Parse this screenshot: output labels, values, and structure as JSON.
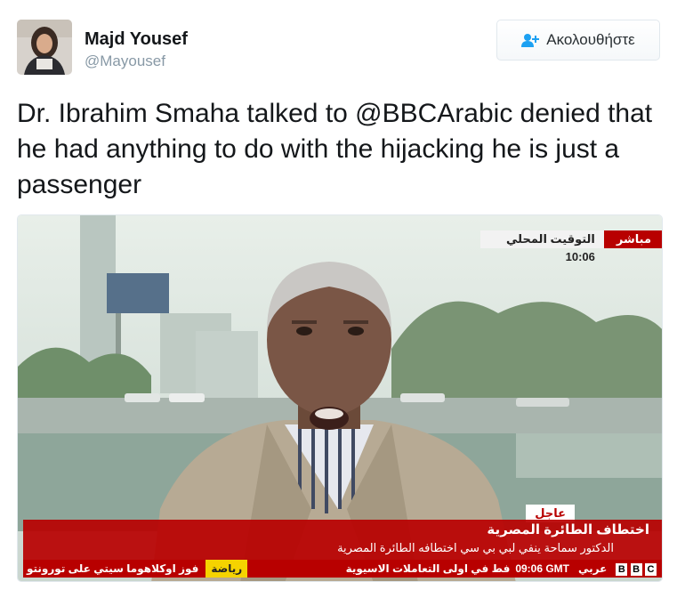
{
  "author": {
    "name": "Majd Yousef",
    "handle": "@Mayousef"
  },
  "follow_button": {
    "label": "Ακολουθήστε",
    "icon": "add-user-icon"
  },
  "tweet": {
    "text": "Dr. Ibrahim Smaha talked to @BBCArabic denied that he had anything to do with the hijacking he is just a passenger"
  },
  "broadcast": {
    "live_label": "مباشر",
    "local_time_label": "التوقيت المحلي 10:06",
    "breaking_label": "عاجل",
    "headline": "اختطاف الطائرة المصرية",
    "subheadline": "الدكتور سماحة ينفي لبي بي سي اختطافه الطائرة المصرية",
    "ticker_left": "فوز اوكلاهوما سيتي على تورونتو",
    "ticker_sport": "رياضة",
    "ticker_mid": "فط في اولى التعاملات الاسيوية",
    "ticker_time": "09:06 GMT",
    "ticker_channel": "عربي",
    "logo": [
      "B",
      "B",
      "C"
    ],
    "colors": {
      "red": "#b80000",
      "sport": "#f5d300"
    }
  }
}
